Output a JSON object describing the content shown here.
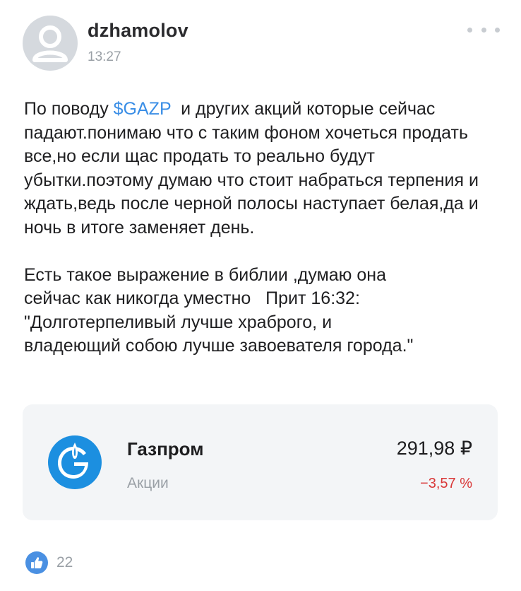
{
  "post": {
    "author": "dzhamolov",
    "time": "13:27",
    "paragraph1": {
      "before": "По поводу ",
      "ticker": "$GAZP",
      "after": "  и других акций которые сейчас падают.понимаю что с таким фоном хочеться продать все,но если щас продать то реально будут убытки.поэтому думаю что стоит набраться терпения и ждать,ведь после черной полосы наступает белая,да и ночь в итоге заменяет день."
    },
    "paragraph2": {
      "line1": "Есть такое выражение в библии ,думаю она",
      "line2": "сейчас как никогда уместно   Прит 16:32:",
      "line3": "\"Долготерпеливый лучше храброго, и",
      "line4": "владеющий собою лучше завоевателя города.\""
    }
  },
  "instrument": {
    "name": "Газпром",
    "type": "Акции",
    "price": "291,98 ₽",
    "change": "−3,57 %",
    "logo_icon": "gazprom-logo-icon"
  },
  "reactions": {
    "likes": "22",
    "like_icon": "thumbs-up-icon"
  },
  "colors": {
    "link": "#3a8ee6",
    "negative": "#d93838",
    "card_bg": "#f3f5f7",
    "like": "#4a90e2"
  }
}
